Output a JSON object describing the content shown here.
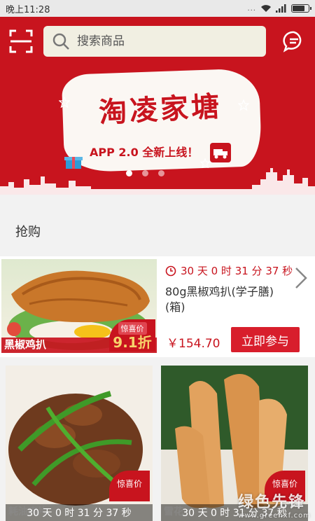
{
  "status_bar": {
    "time": "晚上11:28",
    "dots": "...",
    "battery_level": 0.7
  },
  "header": {
    "search_placeholder": "搜索商品"
  },
  "banner": {
    "title": "淘凌家塘",
    "subtitle": "APP 2.0 全新上线！",
    "active_slide": 0,
    "slide_count": 3
  },
  "section": {
    "title": "抢购"
  },
  "featured": {
    "countdown": "30 天 0 时 31 分 37 秒",
    "product_name": "80g黑椒鸡扒(学子膳)(箱)",
    "price": "￥154.70",
    "join_label": "立即参与",
    "tag_name": "黑椒鸡扒",
    "badge_label": "惊喜价",
    "badge_discount": "9.1折"
  },
  "grid": [
    {
      "tag_name": "耗油肉片",
      "badge_label": "惊喜价",
      "countdown": "30 天 0 时 31 分 37 秒"
    },
    {
      "tag_name": "雪花",
      "badge_label": "惊喜价",
      "countdown": "30 天 0 时 31 分 37 秒"
    }
  ],
  "watermark": {
    "main": "绿色先锋",
    "sub": "www.greenxf.com"
  },
  "colors": {
    "brand_red": "#c8141e",
    "button_red": "#d81e2c",
    "gold": "#f7d36b"
  }
}
